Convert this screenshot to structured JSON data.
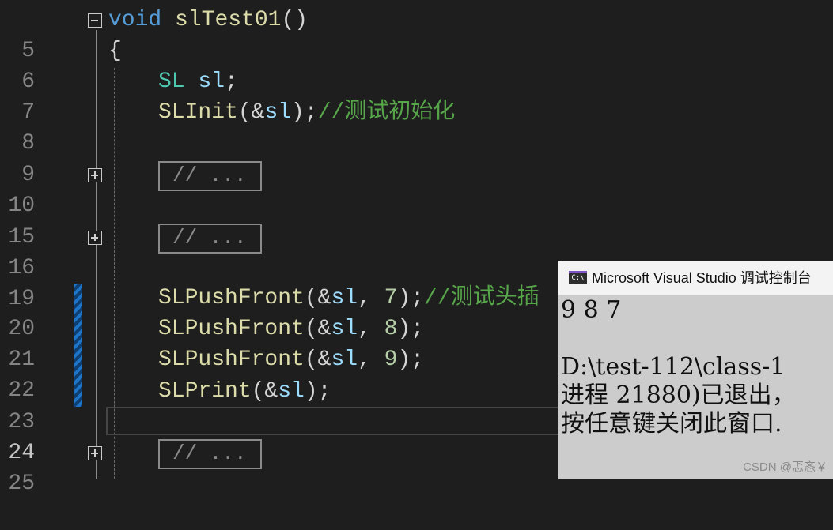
{
  "editor": {
    "lines": [
      {
        "n": "5"
      },
      {
        "n": "6"
      },
      {
        "n": "7"
      },
      {
        "n": "8"
      },
      {
        "n": "9"
      },
      {
        "n": "10"
      },
      {
        "n": "15"
      },
      {
        "n": "16"
      },
      {
        "n": "19"
      },
      {
        "n": "20"
      },
      {
        "n": "21"
      },
      {
        "n": "22"
      },
      {
        "n": "23"
      },
      {
        "n": "24"
      },
      {
        "n": "25"
      }
    ],
    "code": {
      "l5_kw": "void",
      "l5_fn": "slTest01",
      "l5_paren": "()",
      "l6_brace": "{",
      "l7_type": "SL",
      "l7_var": "sl",
      "l7_semi": ";",
      "l8_fn": "SLInit",
      "l8_open": "(&",
      "l8_var": "sl",
      "l8_close": ");",
      "l8_comment": "//测试初始化",
      "collapsed_text": "// ...",
      "push_fn": "SLPushFront",
      "push_open": "(&",
      "push_var": "sl",
      "push_comma": ", ",
      "l20_num": "7",
      "l21_num": "8",
      "l22_num": "9",
      "push_close": ");",
      "l20_comment": "//测试头插",
      "l23_fn": "SLPrint",
      "l23_open": "(&",
      "l23_var": "sl",
      "l23_close": ");"
    }
  },
  "console": {
    "icon_text": "C:\\",
    "title": "Microsoft Visual Studio 调试控制台",
    "output": [
      "9 8 7",
      "",
      "D:\\test-112\\class-1",
      "进程 21880)已退出，",
      "按任意键关闭此窗口."
    ]
  },
  "watermark": "CSDN @忑忞￥",
  "colors": {
    "background": "#1e1e1e",
    "keyword": "#569cd6",
    "function": "#dcdcaa",
    "type": "#4ec9b0",
    "variable": "#9cdcfe",
    "number": "#b5cea8",
    "comment": "#57a64a",
    "change_marker": "#1e75c8"
  }
}
